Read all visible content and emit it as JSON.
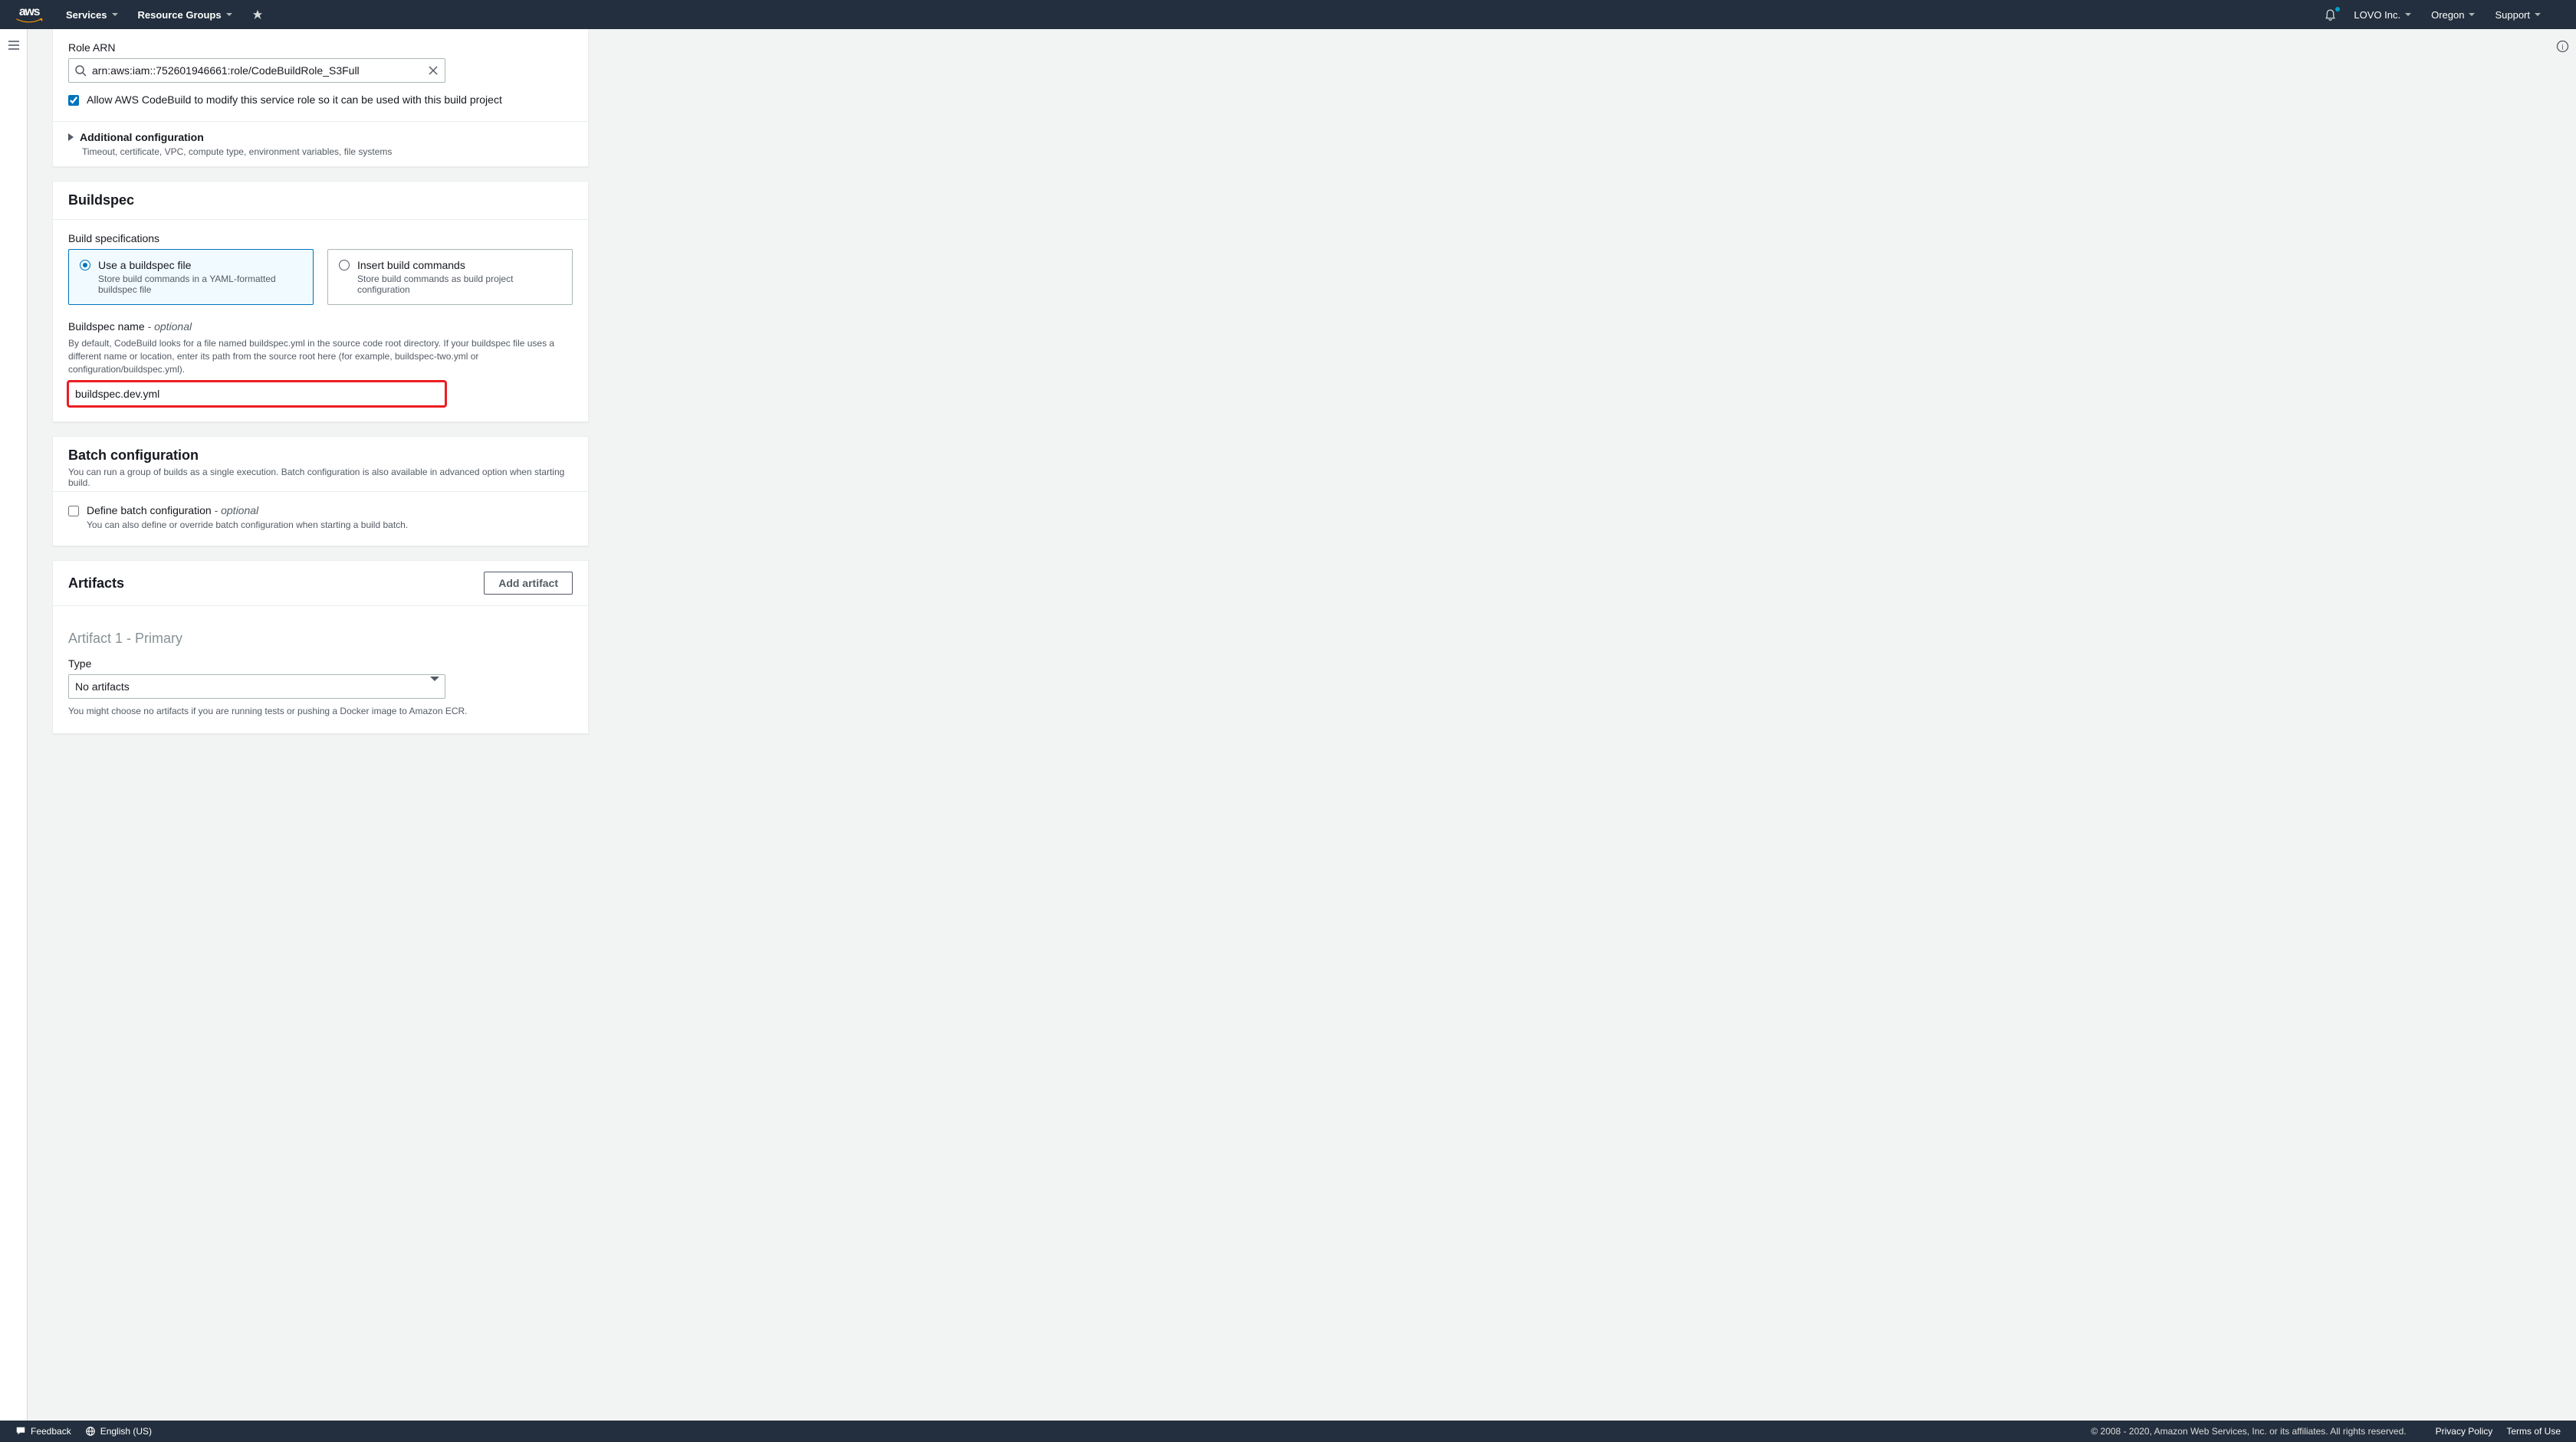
{
  "nav": {
    "logo": "aws",
    "services": "Services",
    "resourceGroups": "Resource Groups",
    "account": "LOVO Inc.",
    "region": "Oregon",
    "support": "Support"
  },
  "roleSection": {
    "label": "Role ARN",
    "value": "arn:aws:iam::752601946661:role/CodeBuildRole_S3Full",
    "allowModify": "Allow AWS CodeBuild to modify this service role so it can be used with this build project",
    "additional": {
      "title": "Additional configuration",
      "sub": "Timeout, certificate, VPC, compute type, environment variables, file systems"
    }
  },
  "buildspec": {
    "title": "Buildspec",
    "specLabel": "Build specifications",
    "option1": {
      "title": "Use a buildspec file",
      "sub": "Store build commands in a YAML-formatted buildspec file"
    },
    "option2": {
      "title": "Insert build commands",
      "sub": "Store build commands as build project configuration"
    },
    "nameLabel": "Buildspec name",
    "optional": " - optional",
    "nameHelper": "By default, CodeBuild looks for a file named buildspec.yml in the source code root directory. If your buildspec file uses a different name or location, enter its path from the source root here (for example, buildspec-two.yml or configuration/buildspec.yml).",
    "nameValue": "buildspec.dev.yml"
  },
  "batch": {
    "title": "Batch configuration",
    "sub": "You can run a group of builds as a single execution. Batch configuration is also available in advanced option when starting build.",
    "checkLabel": "Define batch configuration",
    "checkOptional": " - optional",
    "checkSub": "You can also define or override batch configuration when starting a build batch."
  },
  "artifacts": {
    "title": "Artifacts",
    "addBtn": "Add artifact",
    "subhead": "Artifact 1 - Primary",
    "typeLabel": "Type",
    "typeValue": "No artifacts",
    "typeHelper": "You might choose no artifacts if you are running tests or pushing a Docker image to Amazon ECR."
  },
  "footer": {
    "feedback": "Feedback",
    "language": "English (US)",
    "copyright": "© 2008 - 2020, Amazon Web Services, Inc. or its affiliates. All rights reserved.",
    "privacy": "Privacy Policy",
    "terms": "Terms of Use"
  }
}
